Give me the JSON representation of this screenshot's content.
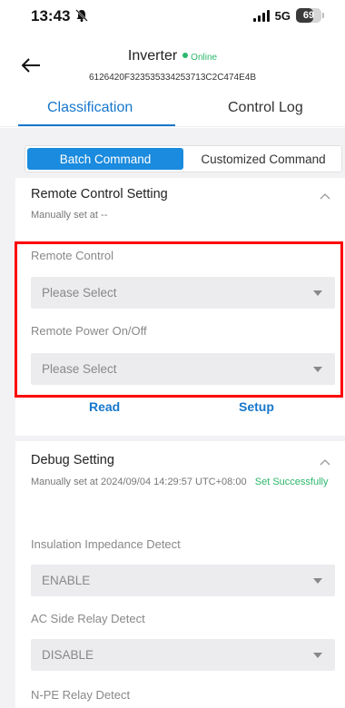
{
  "status_bar": {
    "time": "13:43",
    "network": "5G",
    "battery": "69",
    "battery_level": 0.69
  },
  "header": {
    "title": "Inverter",
    "status": "Online",
    "serial": "6126420F323535334253713C2C474E4B"
  },
  "tabs": [
    {
      "label": "Classification",
      "active": true
    },
    {
      "label": "Control Log",
      "active": false
    }
  ],
  "command_mode": {
    "options": [
      "Batch Command",
      "Customized Command"
    ],
    "selected": "Batch Command"
  },
  "remote_control_setting": {
    "title": "Remote Control Setting",
    "manual_text": "Manually set at --",
    "fields": [
      {
        "label": "Remote Control",
        "value": "Please Select"
      },
      {
        "label": "Remote Power On/Off",
        "value": "Please Select"
      }
    ],
    "read_label": "Read",
    "setup_label": "Setup"
  },
  "debug_setting": {
    "title": "Debug Setting",
    "manual_text": "Manually set at 2024/09/04 14:29:57 UTC+08:00",
    "status_text": "Set Successfully",
    "fields": [
      {
        "label": "Insulation Impedance Detect",
        "value": "ENABLE"
      },
      {
        "label": "AC Side Relay Detect",
        "value": "DISABLE"
      },
      {
        "label": "N-PE Relay Detect",
        "value": ""
      }
    ]
  },
  "colors": {
    "accent": "#1677cc",
    "online": "#2bb76b",
    "highlight_frame": "#ff0000"
  }
}
